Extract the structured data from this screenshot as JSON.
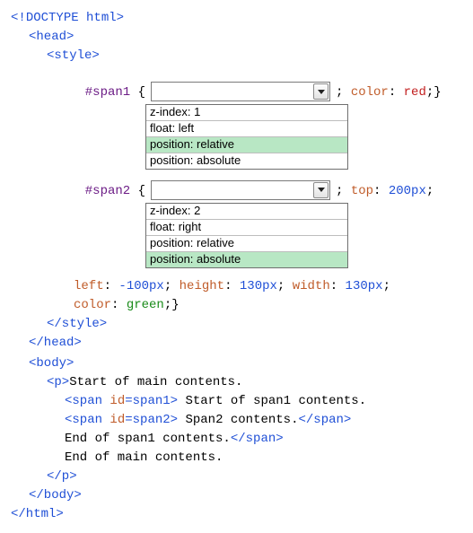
{
  "code": {
    "doctype_open": "<!",
    "doctype_word": "DOCTYPE",
    "doctype_html": " html>",
    "head_open": "<head>",
    "style_open": "<style>",
    "span1_sel": "#span1",
    "brace_open": " {",
    "span1_tail_a": "; ",
    "span1_tail_prop": "color",
    "span1_tail_b": ": ",
    "span1_tail_val": "red",
    "span1_tail_c": ";}",
    "span2_sel": "#span2",
    "span2_tail_a": "; ",
    "span2_tail_prop": "top",
    "span2_tail_b": ": ",
    "span2_tail_val": "200px",
    "span2_tail_c": ";",
    "cont1_a": "left",
    "cont1_b": ": ",
    "cont1_c": "-100px",
    "cont1_d": "; ",
    "cont1_e": "height",
    "cont1_f": ": ",
    "cont1_g": "130px",
    "cont1_h": "; ",
    "cont1_i": "width",
    "cont1_j": ": ",
    "cont1_k": "130px",
    "cont1_l": ";",
    "cont2_a": "color",
    "cont2_b": ": ",
    "cont2_c": "green",
    "cont2_d": ";}",
    "style_close": "</style>",
    "head_close": "</head>",
    "body_open": "<body>",
    "p_open": "<p>",
    "p_text": "Start of main contents.",
    "s1_open_a": "<span ",
    "s1_open_b": "id",
    "s1_open_c": "=",
    "s1_open_d": "span1",
    "s1_open_e": ">",
    "s1_text": " Start of span1 contents.",
    "s2_open_a": "<span ",
    "s2_open_b": "id",
    "s2_open_c": "=",
    "s2_open_d": "span2",
    "s2_open_e": ">",
    "s2_text": " Span2 contents.",
    "span_close": "</span>",
    "end_s1": "End of span1 contents.",
    "end_main": "End of main contents.",
    "p_close": "</p>",
    "body_close": "</body>",
    "html_close": "</html>"
  },
  "dropdown1": {
    "options": {
      "o0": "z-index: 1",
      "o1": "float: left",
      "o2": "position: relative",
      "o3": "position: absolute"
    }
  },
  "dropdown2": {
    "options": {
      "o0": "z-index: 2",
      "o1": "float: right",
      "o2": "position: relative",
      "o3": "position: absolute"
    }
  }
}
